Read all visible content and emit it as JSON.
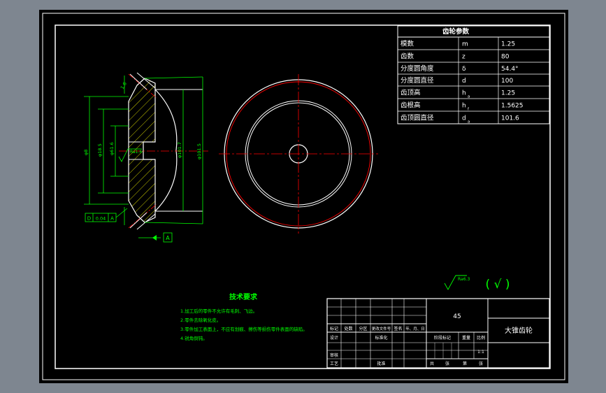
{
  "colors": {
    "background": "#7e8690",
    "paper": "#000000",
    "frame": "#ffffff",
    "centerline": "#ff0000",
    "dimension": "#00ff00",
    "hatch": "#ffff00",
    "text_white": "#ffffff",
    "text_green": "#00ff00"
  },
  "gear_table": {
    "title": "齿轮参数",
    "rows": [
      {
        "name": "模数",
        "symbol": "m",
        "sub": "",
        "value": "1.25"
      },
      {
        "name": "齿数",
        "symbol": "z",
        "sub": "",
        "value": "80"
      },
      {
        "name": "分度圆角度",
        "symbol": "δ",
        "sub": "",
        "value": "54.4°"
      },
      {
        "name": "分度圆直径",
        "symbol": "d",
        "sub": "",
        "value": "100"
      },
      {
        "name": "齿顶高",
        "symbol": "h",
        "sub": "a",
        "value": "1.25"
      },
      {
        "name": "齿根高",
        "symbol": "h",
        "sub": "f",
        "value": "1.5625"
      },
      {
        "name": "齿顶圆直径",
        "symbol": "d",
        "sub": "a",
        "value": "101.6"
      }
    ]
  },
  "section_view": {
    "datum_tag": "A",
    "tol_frame": [
      "D",
      "0.04",
      "A"
    ],
    "roughness": "Ra1.6",
    "dims": [
      "φ8",
      "φ18.5",
      "φ61.6",
      "φ101.7",
      "φ101.5",
      "1.6"
    ]
  },
  "tech_req": {
    "title": "技术要求",
    "items": [
      "1.加工后的零件不允许有毛刺、飞边。",
      "2.零件去除氧化皮。",
      "3.零件加工表面上，不应有划痕、擦伤等损伤零件表面的缺陷。",
      "4.锐角倒钝。"
    ]
  },
  "roughness_note": {
    "symbol_value": "Ra6.3",
    "paren": "( √ )"
  },
  "title_block": {
    "material": "45",
    "part_name": "大锥齿轮",
    "labels": {
      "mark": "标记",
      "count": "处数",
      "zone": "分区",
      "doc_no": "更改文件号",
      "sign": "签名",
      "date": "年、月、日",
      "design": "设计",
      "standard": "标准化",
      "stage_mark": "阶段标记",
      "weight": "重量",
      "scale": "比例",
      "scale_value": "1:1",
      "check": "审核",
      "process": "工艺",
      "approve": "批准",
      "total": "共",
      "sheet_label": "张",
      "of": "第",
      "sheet_label2": "张"
    }
  }
}
